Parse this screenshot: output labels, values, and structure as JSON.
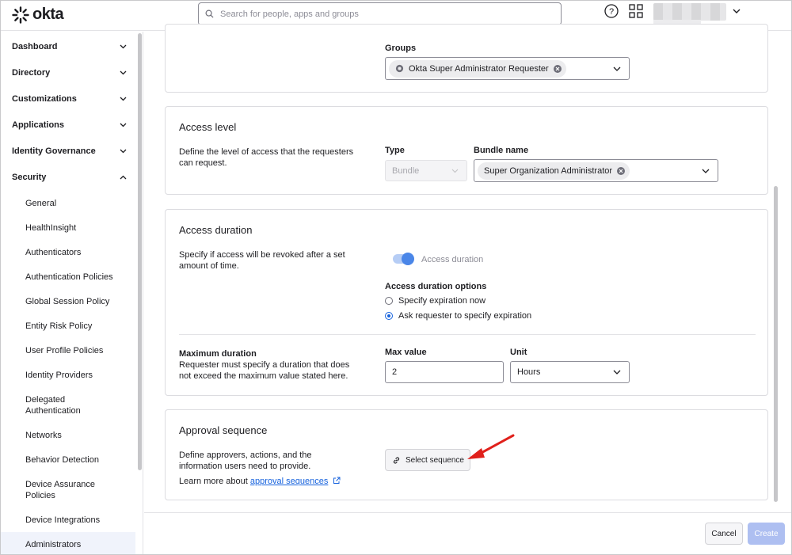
{
  "brand": {
    "name": "okta"
  },
  "search": {
    "placeholder": "Search for people, apps and groups"
  },
  "sidebar": {
    "sections": [
      {
        "label": "Dashboard"
      },
      {
        "label": "Directory"
      },
      {
        "label": "Customizations"
      },
      {
        "label": "Applications"
      },
      {
        "label": "Identity Governance"
      },
      {
        "label": "Security"
      }
    ],
    "security_items": [
      {
        "label": "General"
      },
      {
        "label": "HealthInsight"
      },
      {
        "label": "Authenticators"
      },
      {
        "label": "Authentication Policies"
      },
      {
        "label": "Global Session Policy"
      },
      {
        "label": "Entity Risk Policy"
      },
      {
        "label": "User Profile Policies"
      },
      {
        "label": "Identity Providers"
      },
      {
        "label": "Delegated Authentication"
      },
      {
        "label": "Networks"
      },
      {
        "label": "Behavior Detection"
      },
      {
        "label": "Device Assurance Policies"
      },
      {
        "label": "Device Integrations"
      },
      {
        "label": "Administrators"
      }
    ]
  },
  "groups_card": {
    "label": "Groups",
    "chip": "Okta Super Administrator Requester"
  },
  "access_level": {
    "title": "Access level",
    "description": "Define the level of access that the requesters can request.",
    "type_label": "Type",
    "type_value": "Bundle",
    "bundle_label": "Bundle name",
    "bundle_chip": "Super Organization Administrator"
  },
  "access_duration": {
    "title": "Access duration",
    "description": "Specify if access will be revoked after a set amount of time.",
    "toggle_label": "Access duration",
    "options_label": "Access duration options",
    "option_1": "Specify expiration now",
    "option_2": "Ask requester to specify expiration",
    "max_title": "Maximum duration",
    "max_description": "Requester must specify a duration that does not exceed the maximum value stated here.",
    "max_value_label": "Max value",
    "max_value": "2",
    "unit_label": "Unit",
    "unit_value": "Hours"
  },
  "approval": {
    "title": "Approval sequence",
    "description": "Define approvers, actions, and the information users need to provide.",
    "learn_prefix": "Learn more about ",
    "learn_link": "approval sequences",
    "select_button": "Select sequence"
  },
  "footer": {
    "cancel": "Cancel",
    "create": "Create"
  },
  "colors": {
    "accent": "#1662dd",
    "create_disabled": "#aebff1",
    "annotation_arrow": "#e0201b"
  }
}
